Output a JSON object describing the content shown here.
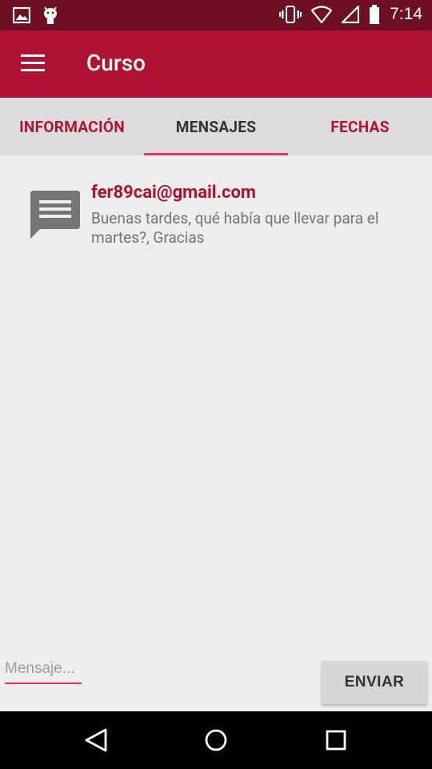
{
  "status_bar": {
    "time": "7:14",
    "left_icons": [
      "image-notification-icon",
      "android-debug-icon"
    ],
    "right_icons": [
      "vibrate-icon",
      "wifi-icon",
      "cell-signal-icon",
      "battery-icon"
    ]
  },
  "toolbar": {
    "title": "Curso",
    "menu_icon": "hamburger-menu-icon",
    "color": "#b01233"
  },
  "tabs": [
    {
      "label": "INFORMACIÓN",
      "active": false
    },
    {
      "label": "MENSAJES",
      "active": true
    },
    {
      "label": "FECHAS",
      "active": false
    }
  ],
  "messages": [
    {
      "icon": "message-bubble-icon",
      "sender": "fer89cai@gmail.com",
      "text": "Buenas tardes, qué había que llevar para el martes?, Gracias"
    }
  ],
  "composer": {
    "placeholder": "Mensaje...",
    "value": "",
    "send_label": "ENVIAR"
  },
  "colors": {
    "accent": "#e8336d",
    "primary": "#b01233",
    "status_bar": "#6e0f24"
  }
}
